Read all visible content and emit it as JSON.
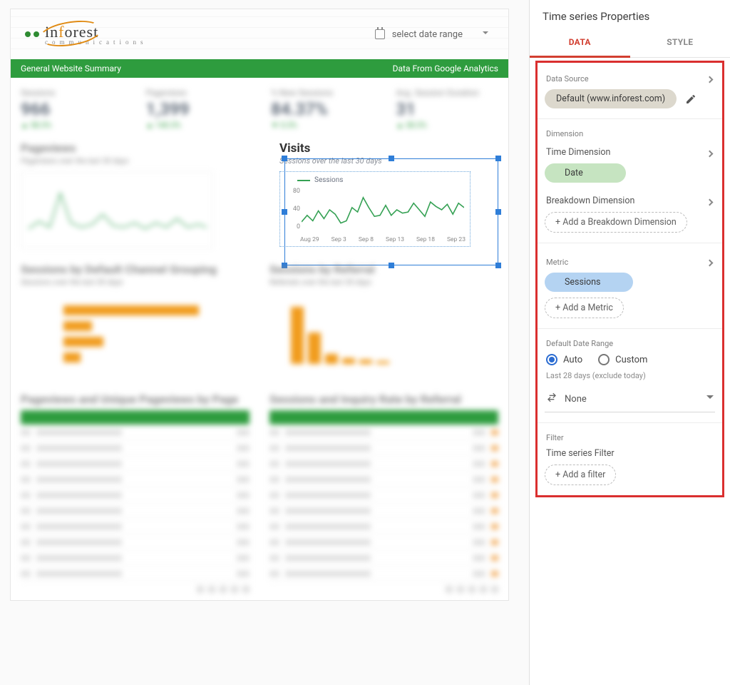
{
  "header": {
    "date_picker_label": "select date range"
  },
  "green_bar": {
    "left": "General Website Summary",
    "right": "Data From Google Analytics"
  },
  "scorecards": [
    {
      "label": "Sessions",
      "value": "966",
      "delta": "▲ 58.3%"
    },
    {
      "label": "Pageviews",
      "value": "1,399",
      "delta": "▲ 140.3%"
    },
    {
      "label": "% New Sessions",
      "value": "84.37%",
      "delta": "▼ 0.3%"
    },
    {
      "label": "Avg. Session Duration",
      "value": "31",
      "delta": "▲ 38.3%"
    }
  ],
  "left_panels": {
    "pageviews": {
      "title": "Pageviews",
      "sub": "Pageviews over the last 30 days"
    },
    "channel": {
      "title": "Sessions by Default Channel Grouping",
      "sub": "Sessions over the last 30 days"
    },
    "table": {
      "title": "Pageviews and Unique Pageviews by Page"
    }
  },
  "right_panels": {
    "referral": {
      "title": "Sessions by Referral",
      "sub": "Referrals over the last 30 days"
    },
    "table": {
      "title": "Sessions and Inquiry Rate by Referral"
    }
  },
  "visits": {
    "title": "Visits",
    "sub": "Sessions over the last 30 days",
    "legend": "Sessions"
  },
  "chart_data": {
    "type": "line",
    "title": "Visits",
    "ylabel": "Sessions",
    "ylim": [
      0,
      80
    ],
    "yticks": [
      0,
      40,
      80
    ],
    "categories": [
      "Aug 29",
      "Sep 3",
      "Sep 8",
      "Sep 13",
      "Sep 18",
      "Sep 23"
    ],
    "series": [
      {
        "name": "Sessions",
        "values": [
          18,
          30,
          20,
          38,
          24,
          40,
          32,
          16,
          20,
          44,
          36,
          62,
          44,
          28,
          30,
          48,
          30,
          40,
          34,
          36,
          52,
          40,
          28,
          54,
          46,
          40,
          50,
          32,
          52,
          44
        ]
      }
    ]
  },
  "side": {
    "title": "Time series Properties",
    "tabs": {
      "data": "DATA",
      "style": "STYLE"
    },
    "data_source": {
      "label": "Data Source",
      "value": "Default (www.inforest.com)"
    },
    "dimension": {
      "label": "Dimension",
      "time_label": "Time Dimension",
      "time_value": "Date",
      "breakdown_label": "Breakdown Dimension",
      "breakdown_add": "+ Add a Breakdown Dimension"
    },
    "metric": {
      "label": "Metric",
      "value": "Sessions",
      "add": "+ Add a Metric"
    },
    "date_range": {
      "label": "Default Date Range",
      "auto": "Auto",
      "custom": "Custom",
      "note": "Last 28 days (exclude today)",
      "compare": "None"
    },
    "filter": {
      "label": "Filter",
      "sub": "Time series Filter",
      "add": "+ Add a filter"
    }
  }
}
